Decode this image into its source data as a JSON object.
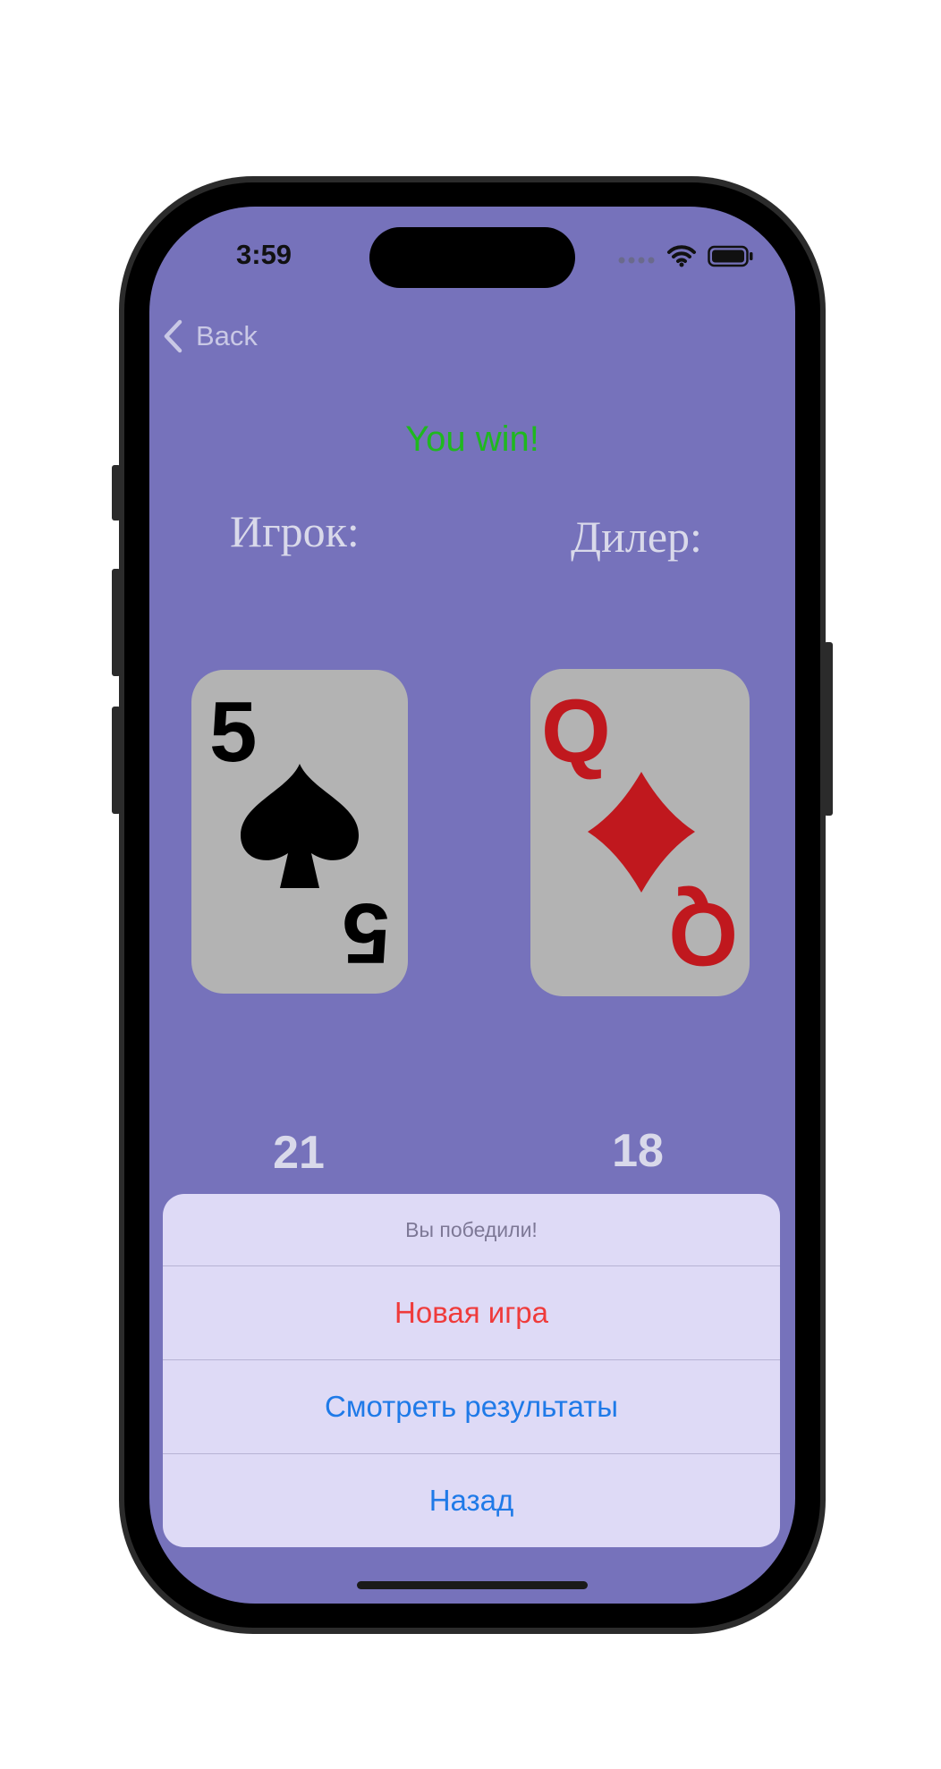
{
  "status_bar": {
    "time": "3:59",
    "icons": [
      "signal-dots-icon",
      "wifi-icon",
      "battery-icon"
    ]
  },
  "nav": {
    "back_label": "Back"
  },
  "game": {
    "result_text": "You win!",
    "player_label": "Игрок:",
    "dealer_label": "Дилер:",
    "player_card": {
      "rank": "5",
      "suit": "spades"
    },
    "dealer_card": {
      "rank": "Q",
      "suit": "diamonds"
    },
    "player_score": "21",
    "dealer_score": "18"
  },
  "action_sheet": {
    "title": "Вы победили!",
    "new_game_label": "Новая игра",
    "results_label": "Смотреть результаты",
    "back_label": "Назад"
  },
  "colors": {
    "screen_background": "#7672bb",
    "win_text": "#1fb81f",
    "destructive_action": "#ef3b3b",
    "default_action": "#1f7ae8",
    "card_background": "#b3b3b3",
    "diamond_red": "#c0181e"
  }
}
